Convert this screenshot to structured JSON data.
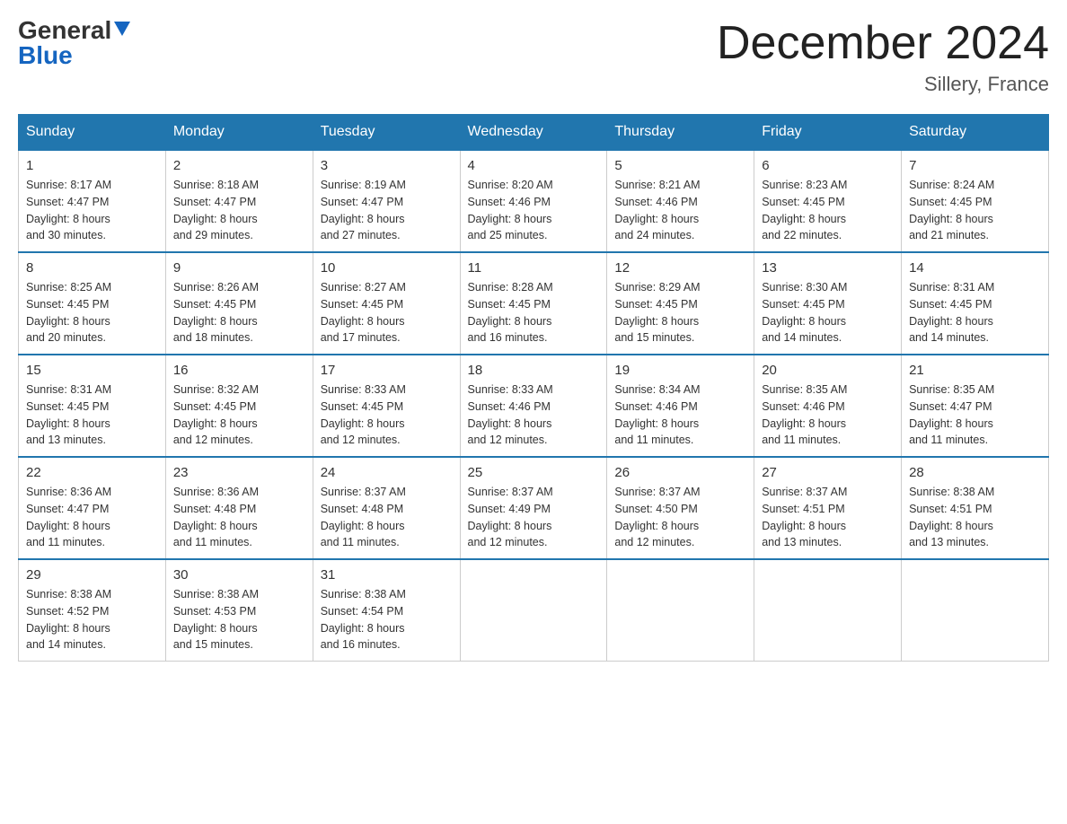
{
  "header": {
    "logo_general": "General",
    "logo_blue": "Blue",
    "month_title": "December 2024",
    "location": "Sillery, France"
  },
  "days_of_week": [
    "Sunday",
    "Monday",
    "Tuesday",
    "Wednesday",
    "Thursday",
    "Friday",
    "Saturday"
  ],
  "weeks": [
    [
      {
        "day": "1",
        "sunrise": "8:17 AM",
        "sunset": "4:47 PM",
        "daylight": "8 hours and 30 minutes."
      },
      {
        "day": "2",
        "sunrise": "8:18 AM",
        "sunset": "4:47 PM",
        "daylight": "8 hours and 29 minutes."
      },
      {
        "day": "3",
        "sunrise": "8:19 AM",
        "sunset": "4:47 PM",
        "daylight": "8 hours and 27 minutes."
      },
      {
        "day": "4",
        "sunrise": "8:20 AM",
        "sunset": "4:46 PM",
        "daylight": "8 hours and 25 minutes."
      },
      {
        "day": "5",
        "sunrise": "8:21 AM",
        "sunset": "4:46 PM",
        "daylight": "8 hours and 24 minutes."
      },
      {
        "day": "6",
        "sunrise": "8:23 AM",
        "sunset": "4:45 PM",
        "daylight": "8 hours and 22 minutes."
      },
      {
        "day": "7",
        "sunrise": "8:24 AM",
        "sunset": "4:45 PM",
        "daylight": "8 hours and 21 minutes."
      }
    ],
    [
      {
        "day": "8",
        "sunrise": "8:25 AM",
        "sunset": "4:45 PM",
        "daylight": "8 hours and 20 minutes."
      },
      {
        "day": "9",
        "sunrise": "8:26 AM",
        "sunset": "4:45 PM",
        "daylight": "8 hours and 18 minutes."
      },
      {
        "day": "10",
        "sunrise": "8:27 AM",
        "sunset": "4:45 PM",
        "daylight": "8 hours and 17 minutes."
      },
      {
        "day": "11",
        "sunrise": "8:28 AM",
        "sunset": "4:45 PM",
        "daylight": "8 hours and 16 minutes."
      },
      {
        "day": "12",
        "sunrise": "8:29 AM",
        "sunset": "4:45 PM",
        "daylight": "8 hours and 15 minutes."
      },
      {
        "day": "13",
        "sunrise": "8:30 AM",
        "sunset": "4:45 PM",
        "daylight": "8 hours and 14 minutes."
      },
      {
        "day": "14",
        "sunrise": "8:31 AM",
        "sunset": "4:45 PM",
        "daylight": "8 hours and 14 minutes."
      }
    ],
    [
      {
        "day": "15",
        "sunrise": "8:31 AM",
        "sunset": "4:45 PM",
        "daylight": "8 hours and 13 minutes."
      },
      {
        "day": "16",
        "sunrise": "8:32 AM",
        "sunset": "4:45 PM",
        "daylight": "8 hours and 12 minutes."
      },
      {
        "day": "17",
        "sunrise": "8:33 AM",
        "sunset": "4:45 PM",
        "daylight": "8 hours and 12 minutes."
      },
      {
        "day": "18",
        "sunrise": "8:33 AM",
        "sunset": "4:46 PM",
        "daylight": "8 hours and 12 minutes."
      },
      {
        "day": "19",
        "sunrise": "8:34 AM",
        "sunset": "4:46 PM",
        "daylight": "8 hours and 11 minutes."
      },
      {
        "day": "20",
        "sunrise": "8:35 AM",
        "sunset": "4:46 PM",
        "daylight": "8 hours and 11 minutes."
      },
      {
        "day": "21",
        "sunrise": "8:35 AM",
        "sunset": "4:47 PM",
        "daylight": "8 hours and 11 minutes."
      }
    ],
    [
      {
        "day": "22",
        "sunrise": "8:36 AM",
        "sunset": "4:47 PM",
        "daylight": "8 hours and 11 minutes."
      },
      {
        "day": "23",
        "sunrise": "8:36 AM",
        "sunset": "4:48 PM",
        "daylight": "8 hours and 11 minutes."
      },
      {
        "day": "24",
        "sunrise": "8:37 AM",
        "sunset": "4:48 PM",
        "daylight": "8 hours and 11 minutes."
      },
      {
        "day": "25",
        "sunrise": "8:37 AM",
        "sunset": "4:49 PM",
        "daylight": "8 hours and 12 minutes."
      },
      {
        "day": "26",
        "sunrise": "8:37 AM",
        "sunset": "4:50 PM",
        "daylight": "8 hours and 12 minutes."
      },
      {
        "day": "27",
        "sunrise": "8:37 AM",
        "sunset": "4:51 PM",
        "daylight": "8 hours and 13 minutes."
      },
      {
        "day": "28",
        "sunrise": "8:38 AM",
        "sunset": "4:51 PM",
        "daylight": "8 hours and 13 minutes."
      }
    ],
    [
      {
        "day": "29",
        "sunrise": "8:38 AM",
        "sunset": "4:52 PM",
        "daylight": "8 hours and 14 minutes."
      },
      {
        "day": "30",
        "sunrise": "8:38 AM",
        "sunset": "4:53 PM",
        "daylight": "8 hours and 15 minutes."
      },
      {
        "day": "31",
        "sunrise": "8:38 AM",
        "sunset": "4:54 PM",
        "daylight": "8 hours and 16 minutes."
      },
      null,
      null,
      null,
      null
    ]
  ],
  "labels": {
    "sunrise": "Sunrise:",
    "sunset": "Sunset:",
    "daylight": "Daylight:"
  }
}
